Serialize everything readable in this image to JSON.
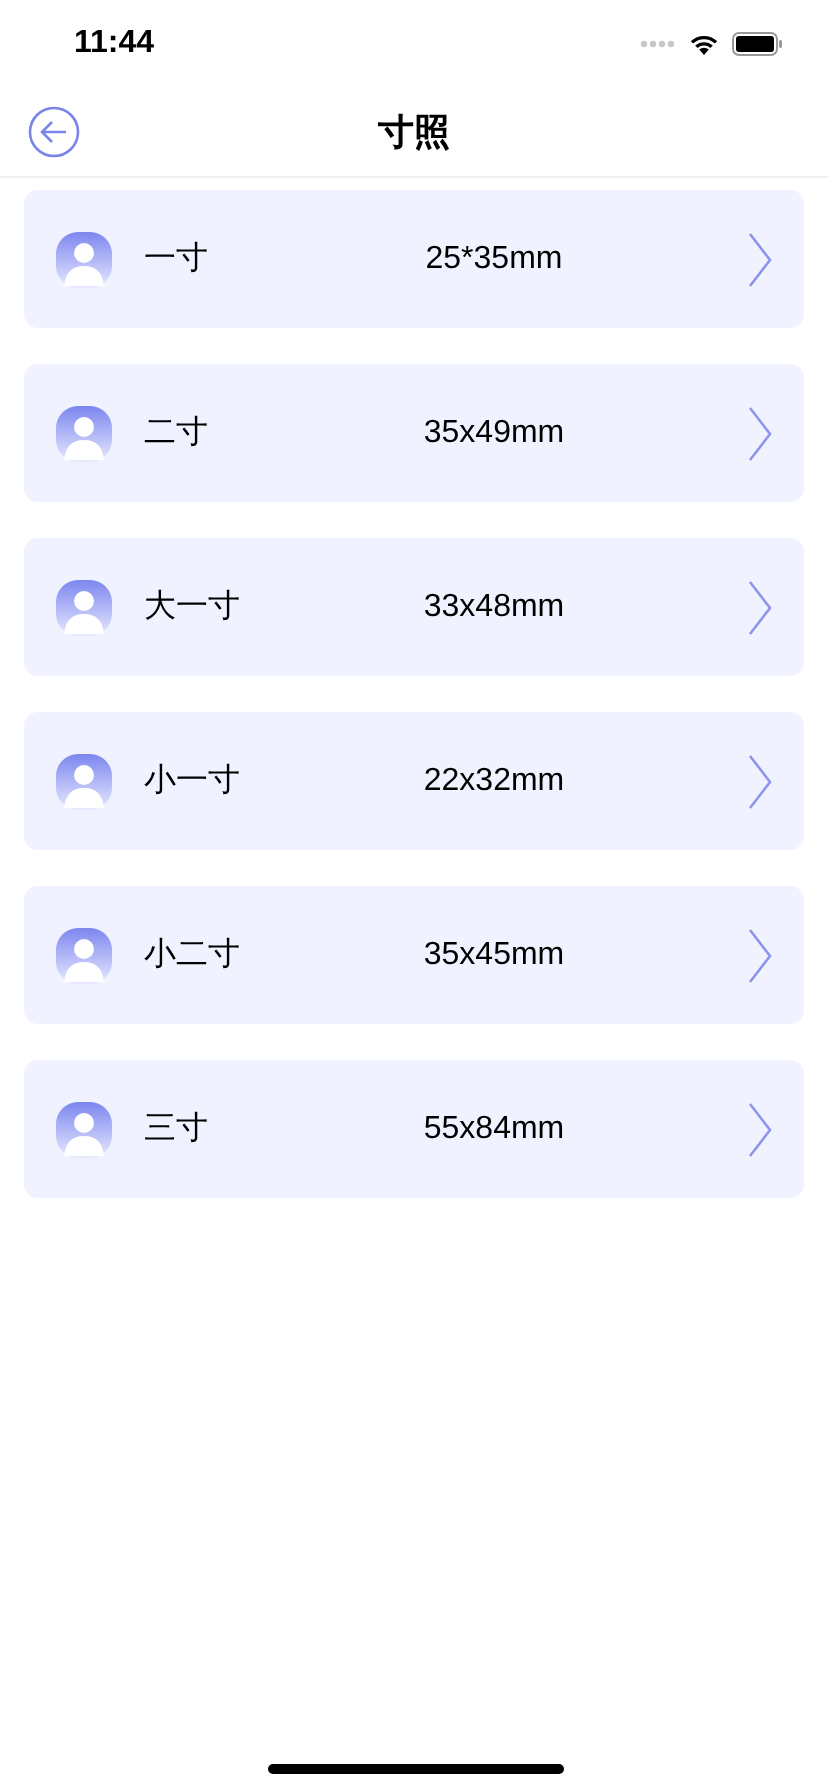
{
  "status_bar": {
    "time": "11:44"
  },
  "nav": {
    "title": "寸照"
  },
  "items": [
    {
      "name": "一寸",
      "size": "25*35mm"
    },
    {
      "name": "二寸",
      "size": "35x49mm"
    },
    {
      "name": "大一寸",
      "size": "33x48mm"
    },
    {
      "name": "小一寸",
      "size": "22x32mm"
    },
    {
      "name": "小二寸",
      "size": "35x45mm"
    },
    {
      "name": "三寸",
      "size": "55x84mm"
    }
  ]
}
